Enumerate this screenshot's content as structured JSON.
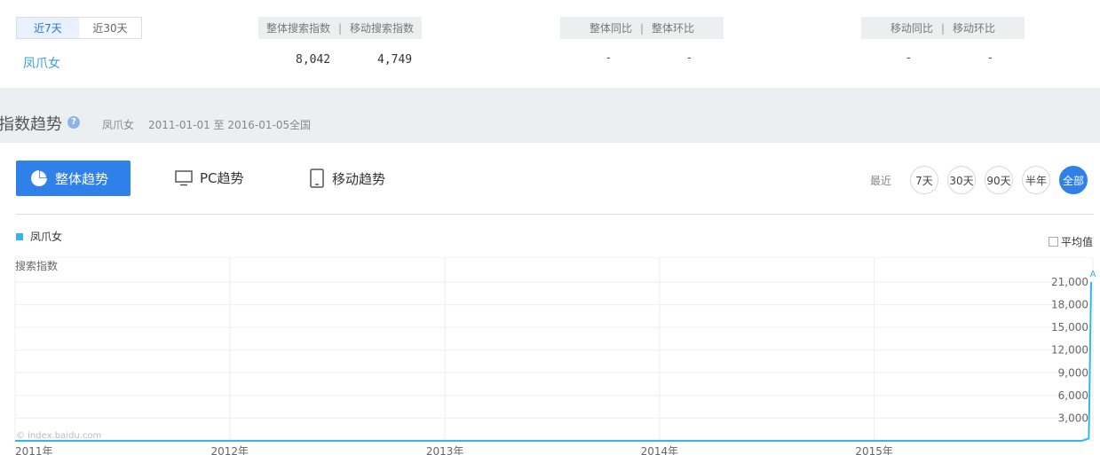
{
  "period": {
    "tabs": [
      "近7天",
      "近30天"
    ],
    "active": 0
  },
  "headers": {
    "search": {
      "a": "整体搜索指数",
      "b": "移动搜索指数"
    },
    "overall_ratio": {
      "a": "整体同比",
      "b": "整体环比"
    },
    "mobile_ratio": {
      "a": "移动同比",
      "b": "移动环比"
    },
    "sep": "|"
  },
  "row": {
    "keyword": "凤爪女",
    "overall_index": "8,042",
    "mobile_index": "4,749",
    "overall_yoy": "-",
    "overall_mom": "-",
    "mobile_yoy": "-",
    "mobile_mom": "-"
  },
  "trend": {
    "title": "指数趋势",
    "help": "?",
    "keyword": "凤爪女",
    "date_range": "2011-01-01 至 2016-01-05",
    "region": "全国"
  },
  "tabs": {
    "overall": "整体趋势",
    "pc": "PC趋势",
    "mobile": "移动趋势"
  },
  "range": {
    "label": "最近",
    "options": [
      "7天",
      "30天",
      "90天",
      "半年",
      "全部"
    ],
    "active": 4
  },
  "legend": {
    "series": "凤爪女",
    "avg_label": "平均值"
  },
  "chart_data": {
    "type": "line",
    "ylabel": "搜索指数",
    "watermark": "© index.baidu.com",
    "peak_marker": "A",
    "x_ticks": [
      "2011年",
      "2012年",
      "2013年",
      "2014年",
      "2015年"
    ],
    "y_ticks": [
      "3,000",
      "6,000",
      "9,000",
      "12,000",
      "15,000",
      "18,000",
      "21,000"
    ],
    "ylim": [
      0,
      21000
    ],
    "xlim": [
      "2011-01-01",
      "2016-01-05"
    ],
    "series": [
      {
        "name": "凤爪女",
        "color": "#33b6f0",
        "points": [
          [
            "2011-01-01",
            0
          ],
          [
            "2015-12-20",
            0
          ],
          [
            "2016-01-01",
            300
          ],
          [
            "2016-01-05",
            21000
          ]
        ]
      }
    ],
    "grid": true
  }
}
